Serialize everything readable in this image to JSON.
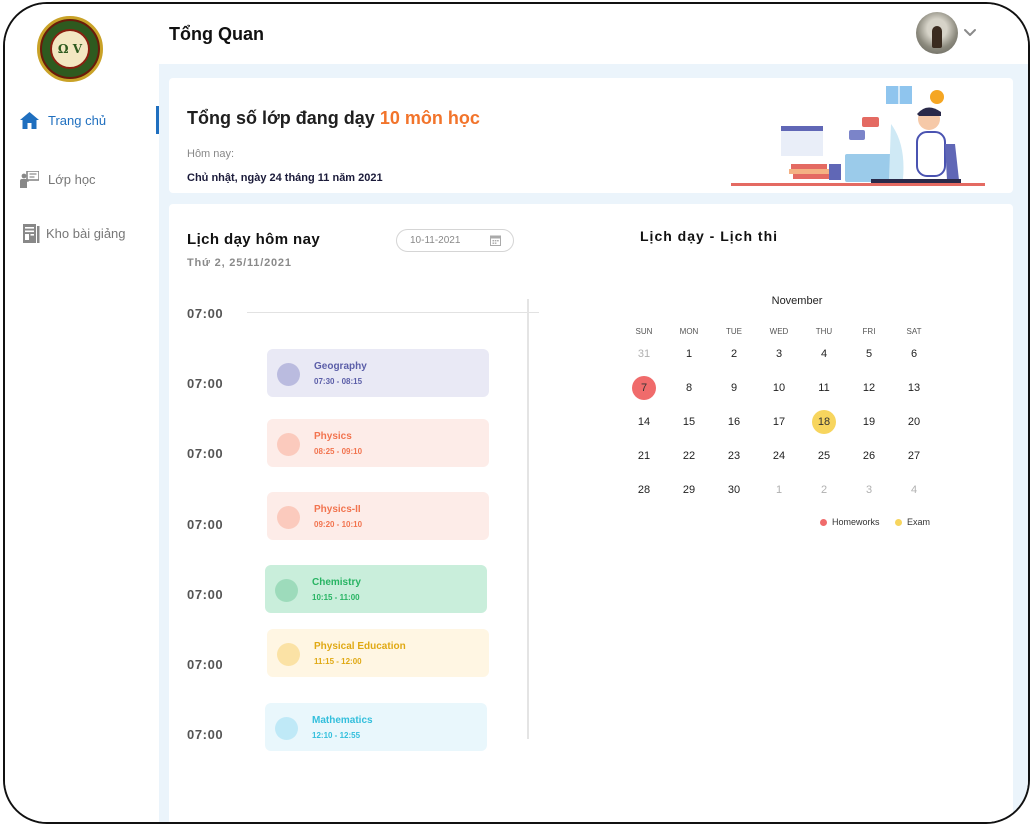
{
  "header": {
    "title": "Tổng Quan"
  },
  "sidebar": {
    "items": [
      {
        "label": "Trang chủ",
        "icon": "home-icon",
        "active": true
      },
      {
        "label": "Lớp học",
        "icon": "teacher-board-icon",
        "active": false
      },
      {
        "label": "Kho bài giảng",
        "icon": "document-icon",
        "active": false
      }
    ]
  },
  "summary": {
    "title_prefix": "Tổng số lớp đang dạy",
    "title_highlight": "10 môn học",
    "today_label": "Hôm nay:",
    "date": "Chủ nhật, ngày 24 tháng 11 năm 2021"
  },
  "schedule": {
    "title": "Lịch dạy hôm nay",
    "subtitle": "Thứ 2, 25/11/2021",
    "date_value": "10-11-2021",
    "time_labels": [
      "07:00",
      "07:00",
      "07:00",
      "07:00",
      "07:00",
      "07:00",
      "07:00"
    ],
    "events": [
      {
        "name": "Geography",
        "time": "07:30 - 08:15",
        "bg": "#e9e9f5",
        "dot": "#babbdf",
        "color": "#5b5ea8"
      },
      {
        "name": "Physics",
        "time": "08:25 - 09:10",
        "bg": "#fdece8",
        "dot": "#fbcabd",
        "color": "#f2744f"
      },
      {
        "name": "Physics-II",
        "time": "09:20 - 10:10",
        "bg": "#fdece8",
        "dot": "#fbcabd",
        "color": "#f2744f"
      },
      {
        "name": "Chemistry",
        "time": "10:15 - 11:00",
        "bg": "#c9eedb",
        "dot": "#9ddbbb",
        "color": "#28b463"
      },
      {
        "name": "Physical Education",
        "time": "11:15 - 12:00",
        "bg": "#fff6e3",
        "dot": "#fbe2a5",
        "color": "#e0a914"
      },
      {
        "name": "Mathematics",
        "time": "12:10 - 12:55",
        "bg": "#e9f7fc",
        "dot": "#bfe9f7",
        "color": "#33bfdc"
      }
    ]
  },
  "calendar": {
    "title": "Lịch dạy - Lịch thi",
    "month": "November",
    "weekdays": [
      "SUN",
      "MON",
      "TUE",
      "WED",
      "THU",
      "FRI",
      "SAT"
    ],
    "weeks": [
      [
        "31",
        "1",
        "2",
        "3",
        "4",
        "5",
        "6"
      ],
      [
        "7",
        "8",
        "9",
        "10",
        "11",
        "12",
        "13"
      ],
      [
        "14",
        "15",
        "16",
        "17",
        "18",
        "19",
        "20"
      ],
      [
        "21",
        "22",
        "23",
        "24",
        "25",
        "26",
        "27"
      ],
      [
        "28",
        "29",
        "30",
        "1",
        "2",
        "3",
        "4"
      ]
    ],
    "muted": [
      [
        0,
        0
      ],
      [
        4,
        3
      ],
      [
        4,
        4
      ],
      [
        4,
        5
      ],
      [
        4,
        6
      ]
    ],
    "homework_days": [
      [
        1,
        0
      ]
    ],
    "exam_days": [
      [
        2,
        4
      ]
    ],
    "legend": [
      {
        "label": "Homeworks",
        "color": "#f06b6b"
      },
      {
        "label": "Exam",
        "color": "#f7d55e"
      }
    ]
  }
}
